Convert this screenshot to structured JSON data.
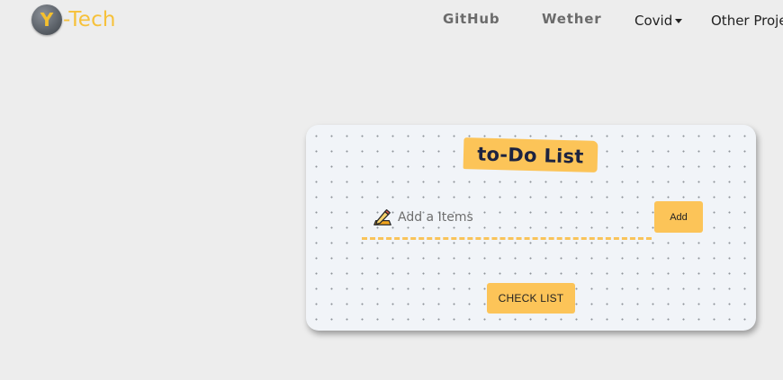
{
  "brand": {
    "logo_letter": "Y",
    "text": "-Tech",
    "color": "#f6c13a"
  },
  "nav": {
    "github": "GitHub",
    "wether": "Wether",
    "covid": "Covid",
    "other": "Other Projects"
  },
  "todo": {
    "title": "to-Do List",
    "input_placeholder": "Add a Items",
    "input_value": "",
    "add_label": "Add",
    "check_list_label": "CHECK LIST",
    "icon": "pencil-icon",
    "accent_color": "#fcc458"
  }
}
